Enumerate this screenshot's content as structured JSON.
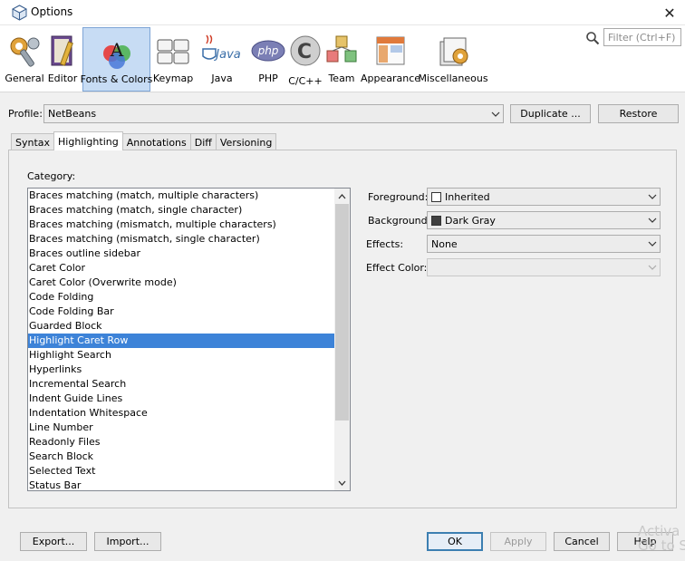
{
  "window": {
    "title": "Options",
    "close_glyph": "✕"
  },
  "categories": [
    {
      "label": "General",
      "icon": "general-icon"
    },
    {
      "label": "Editor",
      "icon": "editor-icon"
    },
    {
      "label": "Fonts & Colors",
      "icon": "fonts-colors-icon",
      "selected": true
    },
    {
      "label": "Keymap",
      "icon": "keymap-icon"
    },
    {
      "label": "Java",
      "icon": "java-icon"
    },
    {
      "label": "PHP",
      "icon": "php-icon"
    },
    {
      "label": "C/C++",
      "icon": "cpp-icon"
    },
    {
      "label": "Team",
      "icon": "team-icon"
    },
    {
      "label": "Appearance",
      "icon": "appearance-icon"
    },
    {
      "label": "Miscellaneous",
      "icon": "miscellaneous-icon"
    }
  ],
  "search": {
    "placeholder": "Filter (Ctrl+F)"
  },
  "profile": {
    "label": "Profile:",
    "value": "NetBeans",
    "duplicate_label": "Duplicate ...",
    "restore_label": "Restore"
  },
  "tabs": [
    "Syntax",
    "Highlighting",
    "Annotations",
    "Diff",
    "Versioning"
  ],
  "active_tab": "Highlighting",
  "category_list": {
    "label": "Category:",
    "items": [
      "Braces matching (match, multiple characters)",
      "Braces matching (match, single character)",
      "Braces matching (mismatch, multiple characters)",
      "Braces matching (mismatch, single character)",
      "Braces outline sidebar",
      "Caret Color",
      "Caret Color (Overwrite mode)",
      "Code Folding",
      "Code Folding Bar",
      "Guarded Block",
      "Highlight Caret Row",
      "Highlight Search",
      "Hyperlinks",
      "Incremental Search",
      "Indent Guide Lines",
      "Indentation Whitespace",
      "Line Number",
      "Readonly Files",
      "Search Block",
      "Selected Text",
      "Status Bar"
    ],
    "selected": "Highlight Caret Row"
  },
  "properties": {
    "foreground": {
      "label": "Foreground:",
      "value": "Inherited",
      "swatch": "#ffffff"
    },
    "background": {
      "label": "Background:",
      "value": "Dark Gray",
      "swatch": "#404040"
    },
    "effects": {
      "label": "Effects:",
      "value": "None"
    },
    "effect_color": {
      "label": "Effect Color:",
      "value": ""
    }
  },
  "footer": {
    "export_label": "Export...",
    "import_label": "Import...",
    "ok_label": "OK",
    "apply_label": "Apply",
    "cancel_label": "Cancel",
    "help_label": "Help"
  },
  "watermark": {
    "line1": "Activa",
    "line2": "Go to S"
  },
  "colors": {
    "selection": "#3d83d8",
    "selected_category_bg": "#c7dcf4"
  }
}
